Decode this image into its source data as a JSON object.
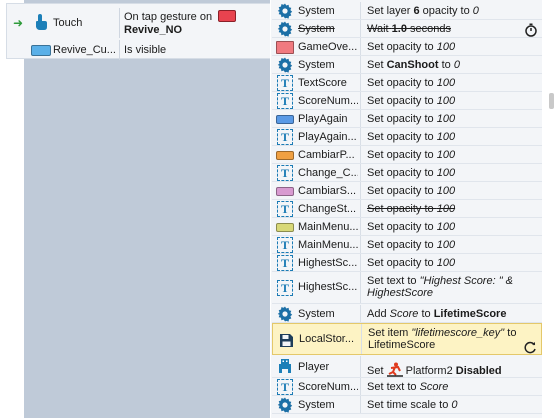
{
  "conditions": {
    "rows": [
      {
        "object": "Touch",
        "text": "On tap gesture on ",
        "target": "Revive_NO"
      },
      {
        "object": "Revive_Cu...",
        "text": "Is visible"
      }
    ]
  },
  "actions": [
    {
      "object": "System",
      "parts": [
        "Set layer ",
        "6",
        " opacity to ",
        "0"
      ]
    },
    {
      "object": "System",
      "parts": [
        "Wait ",
        "1.0",
        " seconds"
      ],
      "disabled": true
    },
    {
      "object": "GameOve...",
      "parts": [
        "Set opacity to ",
        "100"
      ]
    },
    {
      "object": "System",
      "parts": [
        "Set ",
        "CanShoot",
        " to ",
        "0"
      ]
    },
    {
      "object": "TextScore",
      "parts": [
        "Set opacity to ",
        "100"
      ]
    },
    {
      "object": "ScoreNum...",
      "parts": [
        "Set opacity to ",
        "100"
      ]
    },
    {
      "object": "PlayAgain",
      "parts": [
        "Set opacity to ",
        "100"
      ]
    },
    {
      "object": "PlayAgain...",
      "parts": [
        "Set opacity to ",
        "100"
      ]
    },
    {
      "object": "CambiarP...",
      "parts": [
        "Set opacity to ",
        "100"
      ]
    },
    {
      "object": "Change_C...",
      "parts": [
        "Set opacity to ",
        "100"
      ]
    },
    {
      "object": "CambiarS...",
      "parts": [
        "Set opacity to ",
        "100"
      ]
    },
    {
      "object": "ChangeSt...",
      "parts": [
        "Set opacity to ",
        "100"
      ],
      "disabled": true
    },
    {
      "object": "MainMenu...",
      "parts": [
        "Set opacity to ",
        "100"
      ]
    },
    {
      "object": "MainMenu...",
      "parts": [
        "Set opacity to ",
        "100"
      ]
    },
    {
      "object": "HighestSc...",
      "parts": [
        "Set opacity to ",
        "100"
      ]
    },
    {
      "object": "HighestSc...",
      "parts": [
        "Set text to ",
        "\"Highest Score: \" &",
        "HighestScore"
      ]
    },
    {
      "object": "System",
      "parts": [
        "Add ",
        "Score",
        " to ",
        "LifetimeScore"
      ]
    },
    {
      "object": "LocalStor...",
      "parts": [
        "Set item ",
        "\"lifetimescore_key\"",
        " to",
        "LifetimeScore"
      ]
    },
    {
      "object": "Player",
      "parts": [
        "Set ",
        "Platform2",
        " Disabled"
      ]
    },
    {
      "object": "ScoreNum...",
      "parts": [
        "Set text to ",
        "Score"
      ]
    },
    {
      "object": "System",
      "parts": [
        "Set time scale to ",
        "0"
      ]
    }
  ],
  "colors": {
    "gameover_swatch": "#f07a80",
    "playagain_swatch": "#5a9ae6",
    "cambiarp_swatch": "#f0a042",
    "cambiars_swatch": "#d89ad0",
    "mainmenu_swatch": "#d8d878",
    "revive_swatch": "#5ab0e8",
    "revive_no_swatch": "#e8434f"
  },
  "icons": {
    "system": "gear-icon",
    "text": "text-object-icon",
    "touch": "touch-hand-icon",
    "localstorage": "save-icon",
    "player": "player-sprite-icon",
    "platform": "platform-behavior-icon",
    "timer": "stopwatch-icon",
    "refresh": "refresh-icon"
  }
}
